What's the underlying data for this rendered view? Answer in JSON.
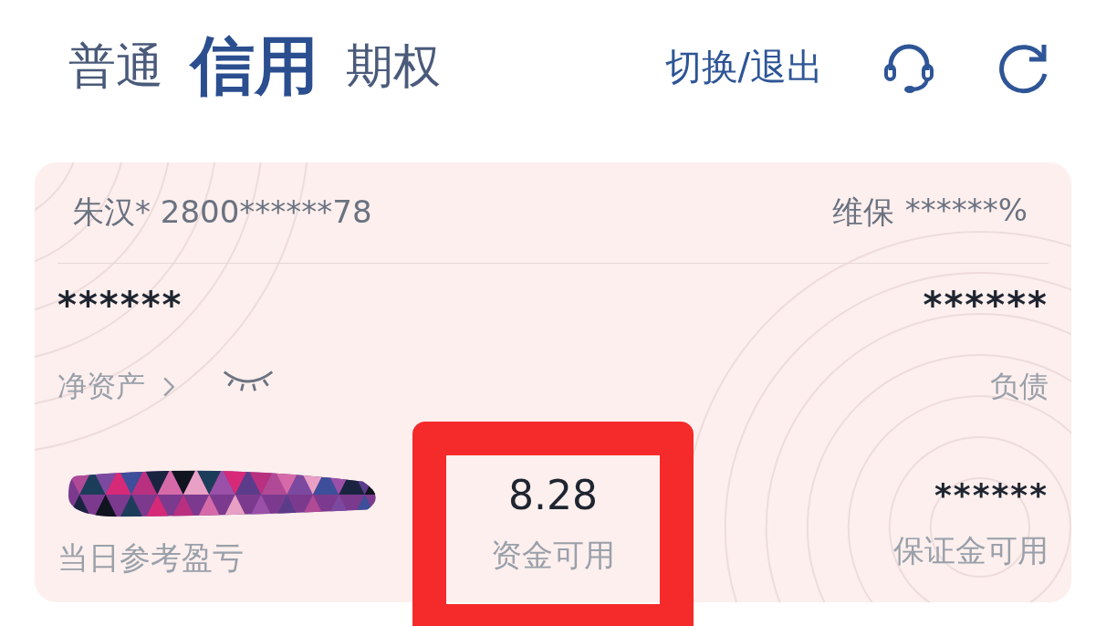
{
  "tabs": [
    {
      "label": "普通",
      "selected": false
    },
    {
      "label": "信用",
      "selected": true
    },
    {
      "label": "期权",
      "selected": false
    }
  ],
  "switch_link": "切换/退出",
  "account": {
    "name": "朱汉* 2800******78",
    "maintenance_label": "维保",
    "maintenance_value": "******%"
  },
  "net_assets": {
    "value": "******",
    "label": "净资产",
    "hidden": true
  },
  "liabilities": {
    "value": "******",
    "label": "负债"
  },
  "stats": [
    {
      "kind": "redacted",
      "label": "当日参考盈亏",
      "highlighted": false
    },
    {
      "kind": "value",
      "value": "8.28",
      "label": "资金可用",
      "highlighted": true
    },
    {
      "kind": "value",
      "value": "******",
      "label": "保证金可用",
      "highlighted": false
    }
  ]
}
